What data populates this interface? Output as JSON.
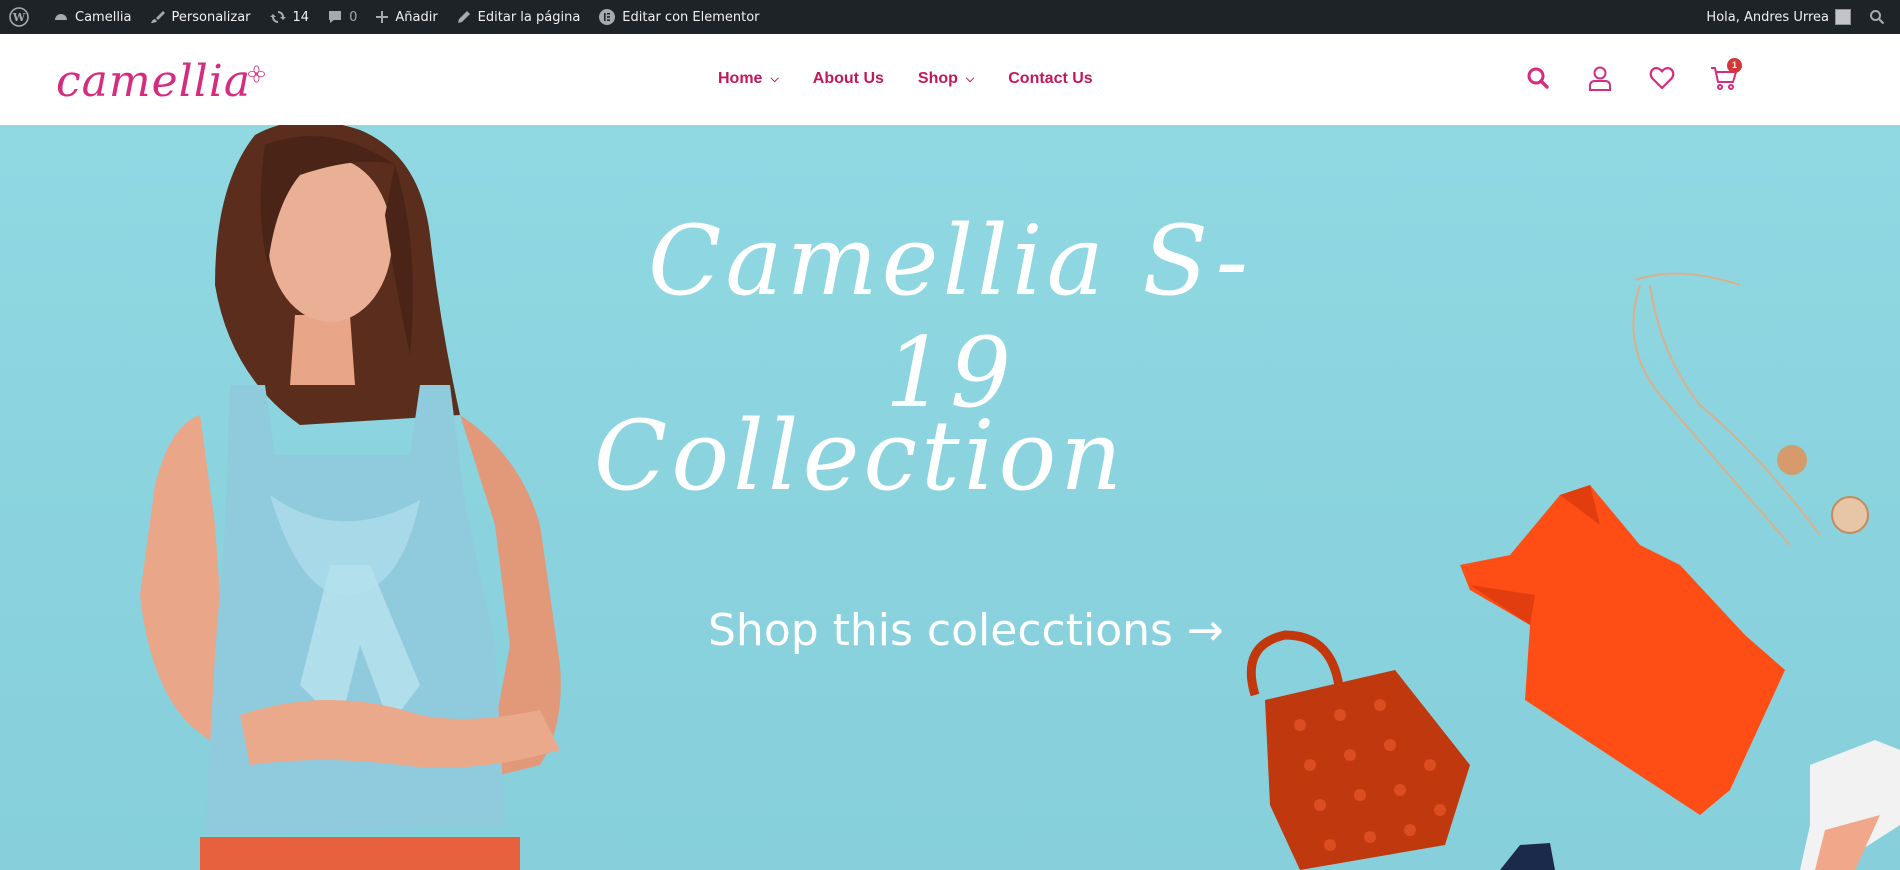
{
  "admin_bar": {
    "site_name": "Camellia",
    "customize": "Personalizar",
    "updates_count": "14",
    "comments_count": "0",
    "new_label": "Añadir",
    "edit_page": "Editar la página",
    "edit_elementor": "Editar con Elementor",
    "greeting": "Hola, Andres Urrea"
  },
  "header": {
    "logo_text": "camellia",
    "nav": [
      {
        "label": "Home",
        "has_dropdown": true
      },
      {
        "label": "About Us",
        "has_dropdown": false
      },
      {
        "label": "Shop",
        "has_dropdown": true
      },
      {
        "label": "Contact Us",
        "has_dropdown": false
      }
    ],
    "icons": [
      "search-icon",
      "user-icon",
      "heart-icon",
      "cart-icon"
    ],
    "cart_count": "1"
  },
  "hero": {
    "title_line1": "Camellia S-19",
    "title_line2": "Collection",
    "cta": "Shop this colecctions →"
  },
  "colors": {
    "brand": "#d42c7e",
    "nav": "#c2185b",
    "admin_bar": "#1d2327",
    "hero_bg": "#8ad3de",
    "badge": "#d63638"
  }
}
